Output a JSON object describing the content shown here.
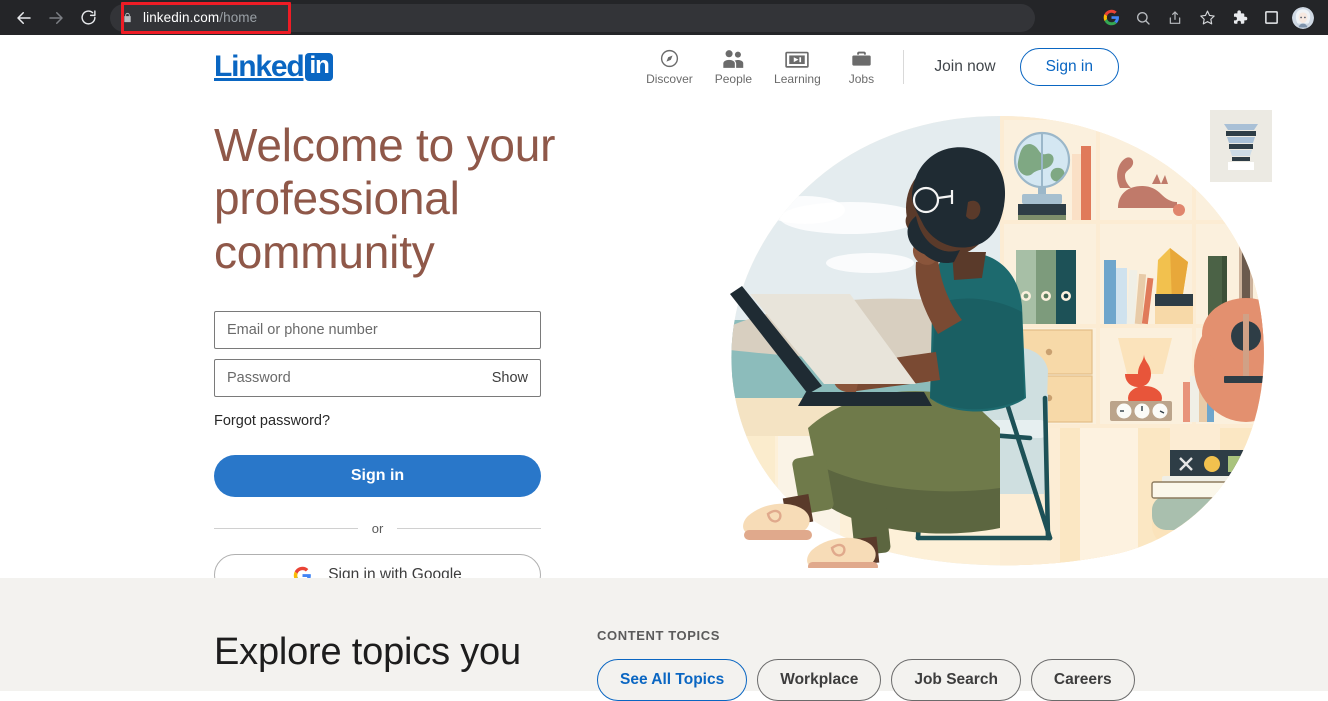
{
  "browser": {
    "back_icon": "back-arrow-icon",
    "forward_icon": "forward-arrow-icon",
    "reload_icon": "reload-icon",
    "lock_icon": "lock-icon",
    "url_domain": "linkedin.com",
    "url_path": "/home",
    "url_full": "linkedin.com/home",
    "highlight_color": "#ee1c25",
    "actions": [
      {
        "name": "google-icon",
        "label": "Google"
      },
      {
        "name": "search-icon",
        "label": "Search"
      },
      {
        "name": "share-icon",
        "label": "Share"
      },
      {
        "name": "bookmark-star-icon",
        "label": "Bookmark"
      },
      {
        "name": "extensions-puzzle-icon",
        "label": "Extensions"
      },
      {
        "name": "sidebar-panel-icon",
        "label": "Side panel"
      },
      {
        "name": "profile-avatar",
        "label": "Profile"
      }
    ]
  },
  "header": {
    "logo_text": "Linked",
    "logo_badge": "in",
    "brand_color": "#0a66c2",
    "nav": [
      {
        "label": "Discover",
        "icon": "compass-icon"
      },
      {
        "label": "People",
        "icon": "people-icon"
      },
      {
        "label": "Learning",
        "icon": "learning-video-icon"
      },
      {
        "label": "Jobs",
        "icon": "briefcase-icon"
      }
    ],
    "join_now": "Join now",
    "sign_in": "Sign in"
  },
  "hero": {
    "title_line1": "Welcome to your",
    "title_line2": "professional community",
    "title_color": "#8f5849",
    "form": {
      "email_placeholder": "Email or phone number",
      "email_value": "",
      "password_placeholder": "Password",
      "password_value": "",
      "show_label": "Show",
      "forgot_label": "Forgot password?",
      "submit_label": "Sign in",
      "or_label": "or",
      "google_label": "Sign in with Google",
      "google_icon": "google-g-icon",
      "submit_color": "#2977c9"
    },
    "illustration": {
      "name": "person-reading-laptop-illustration",
      "description": "Bearded man with glasses sitting in a chair using a laptop in front of a bookshelf with a globe, cat, books, plant, lamp, clocks and a guitar, with a beach landscape behind"
    }
  },
  "explore": {
    "title": "Explore topics you",
    "topics_label": "CONTENT TOPICS",
    "pills": [
      {
        "label": "See All Topics",
        "active": true
      },
      {
        "label": "Workplace",
        "active": false
      },
      {
        "label": "Job Search",
        "active": false
      },
      {
        "label": "Careers",
        "active": false
      }
    ]
  }
}
